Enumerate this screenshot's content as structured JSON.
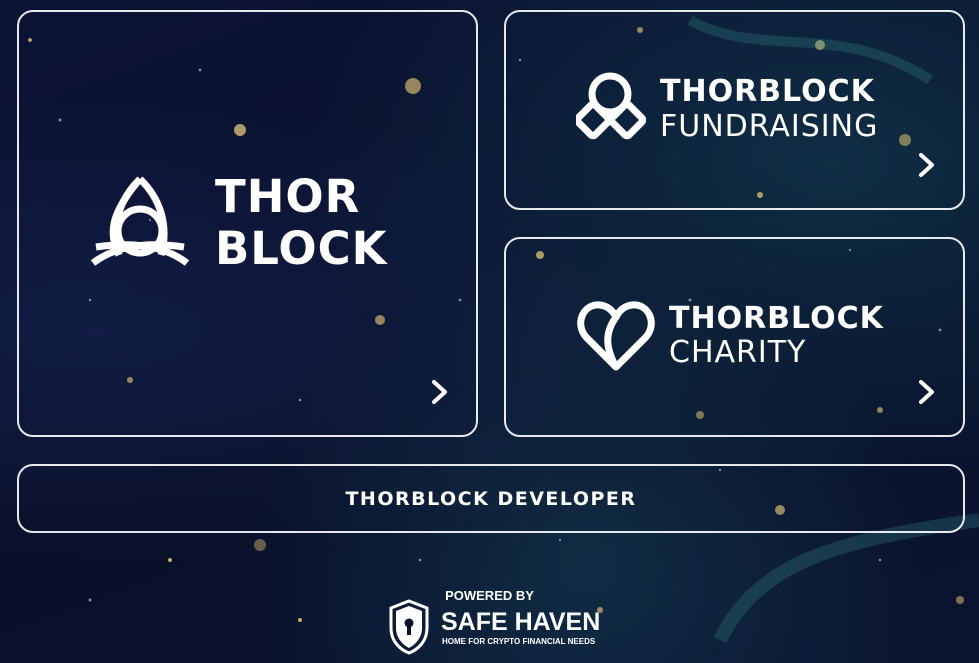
{
  "cards": {
    "thorblock": {
      "line1": "THOR",
      "line2": "BLOCK"
    },
    "fundraising": {
      "brand": "THORBLOCK",
      "product": "FUNDRAISING"
    },
    "charity": {
      "brand": "THORBLOCK",
      "product": "CHARITY"
    },
    "developer": {
      "label": "THORBLOCK DEVELOPER"
    }
  },
  "footer": {
    "powered_by": "POWERED BY",
    "brand": "SAFE HAVEN",
    "tagline": "HOME FOR CRYPTO FINANCIAL NEEDS"
  },
  "icons": {
    "thorblock": "triquetra-icon",
    "fundraising": "interlocked-links-icon",
    "charity": "heart-icon",
    "chevron": "chevron-right-icon",
    "shield": "shield-lock-icon"
  },
  "colors": {
    "background": "#0a1030",
    "foreground": "#ffffff"
  }
}
